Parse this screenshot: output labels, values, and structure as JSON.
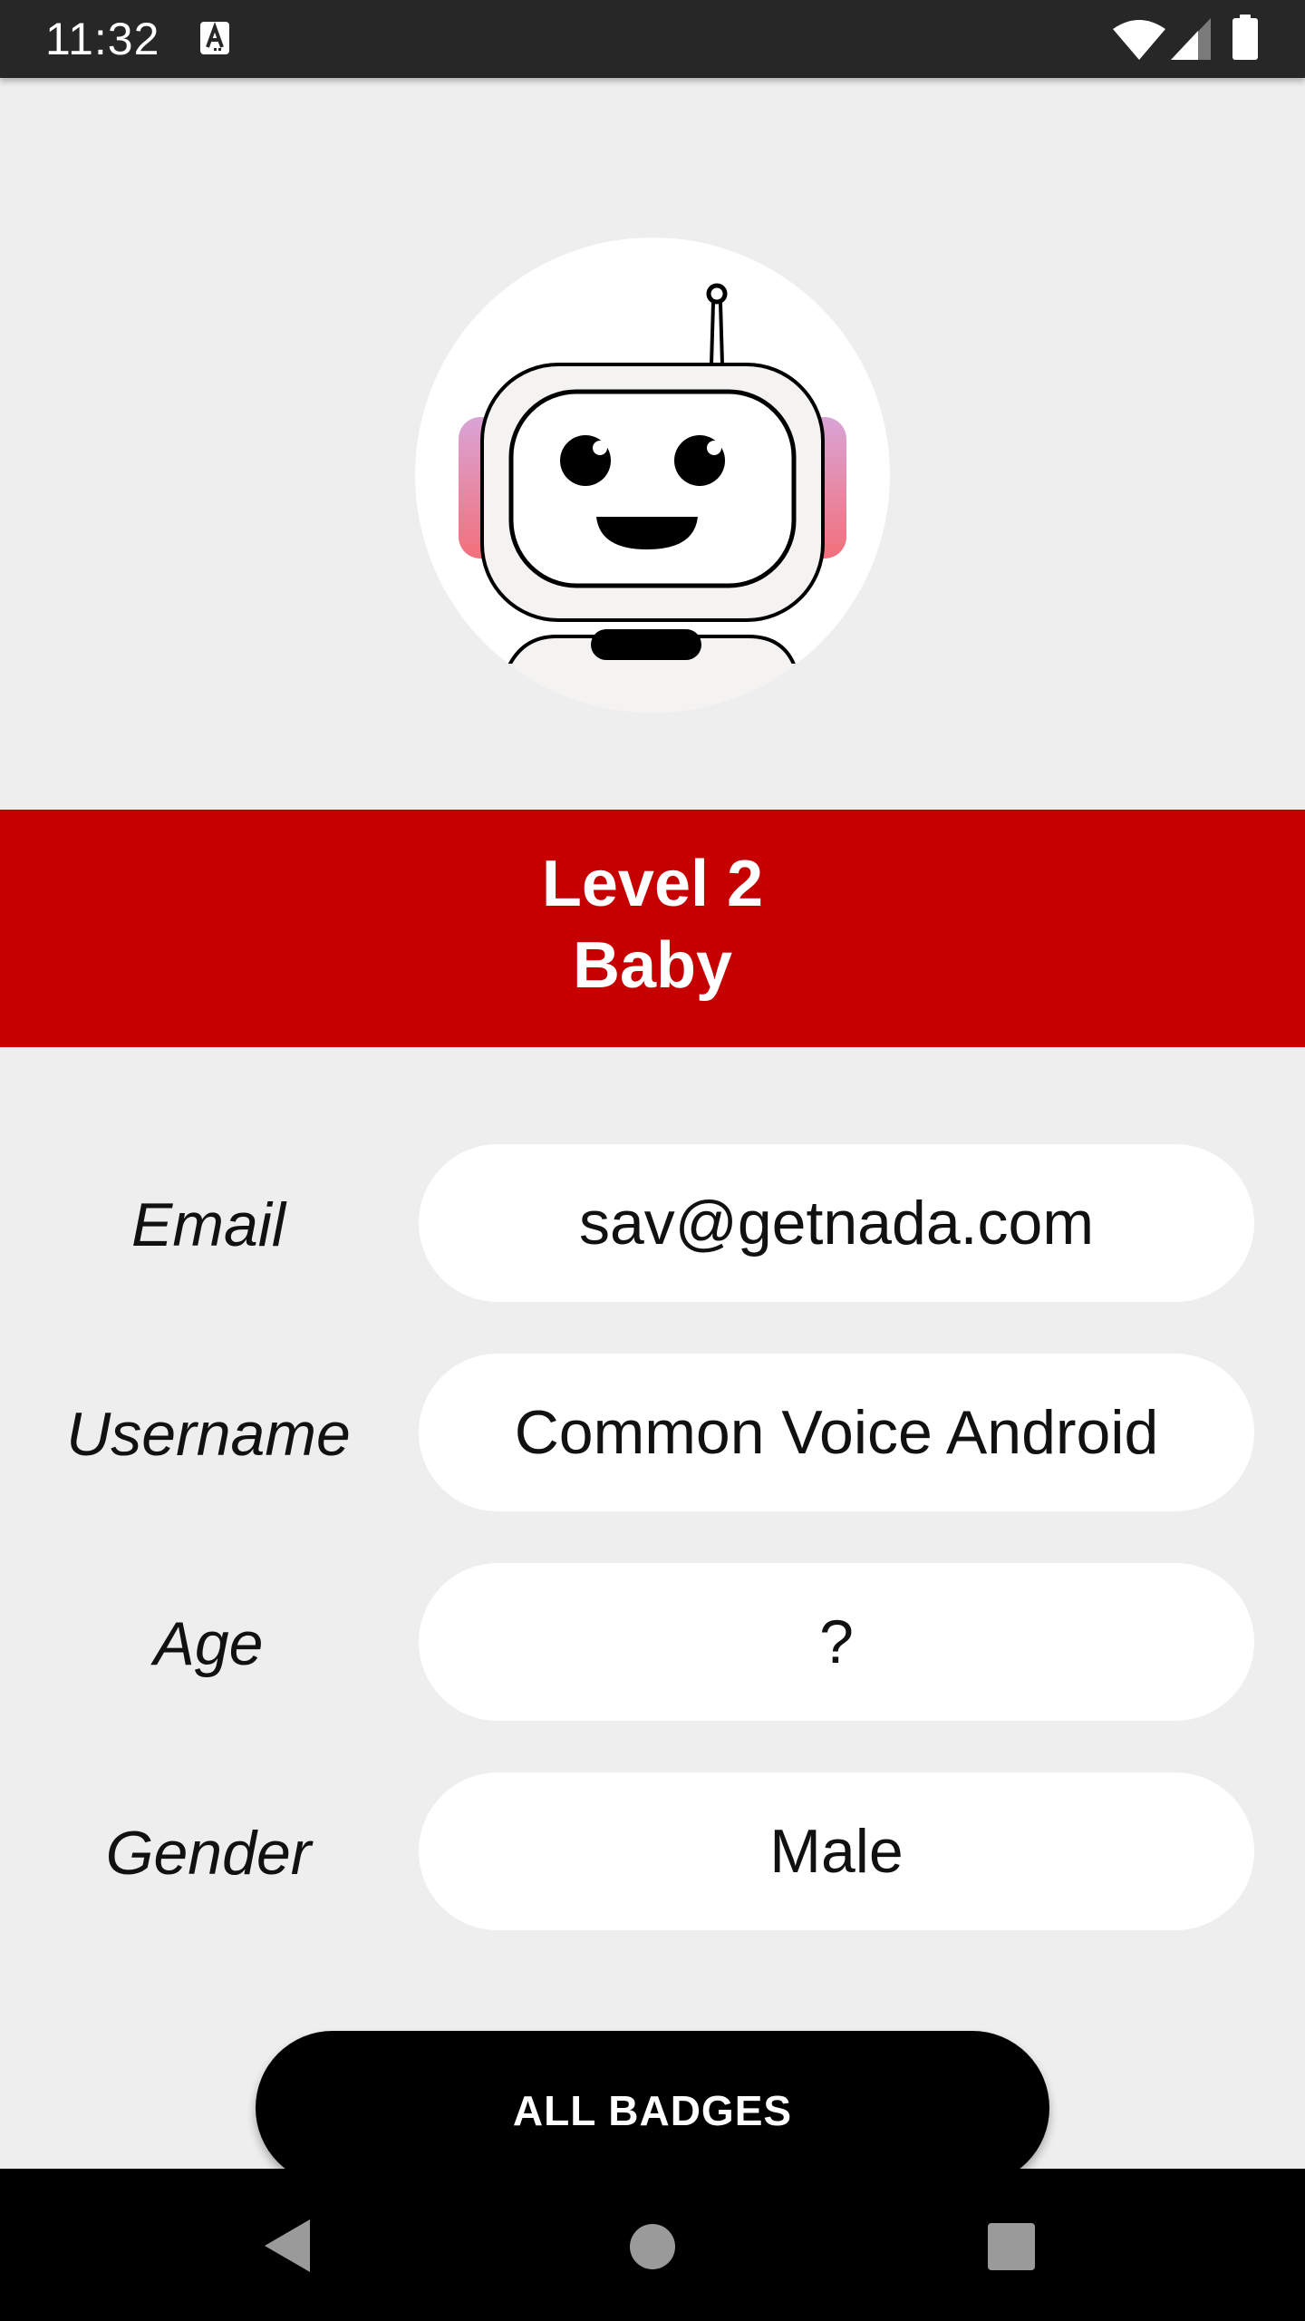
{
  "status_bar": {
    "time": "11:32",
    "icons": [
      "a-notification-icon",
      "wifi-icon",
      "signal-icon",
      "battery-icon"
    ]
  },
  "avatar": {
    "icon": "robot-icon"
  },
  "level": {
    "title": "Level 2",
    "name": "Baby"
  },
  "profile": {
    "fields": [
      {
        "label": "Email",
        "value": "sav@getnada.com"
      },
      {
        "label": "Username",
        "value": "Common Voice Android"
      },
      {
        "label": "Age",
        "value": "?"
      },
      {
        "label": "Gender",
        "value": "Male"
      }
    ]
  },
  "actions": {
    "all_badges_label": "ALL BADGES"
  },
  "nav_bar": {
    "icons": [
      "back-icon",
      "home-icon",
      "recents-icon"
    ]
  },
  "colors": {
    "banner": "#c60000",
    "background": "#eeeeee",
    "status_bar": "#272727",
    "button": "#000000"
  }
}
